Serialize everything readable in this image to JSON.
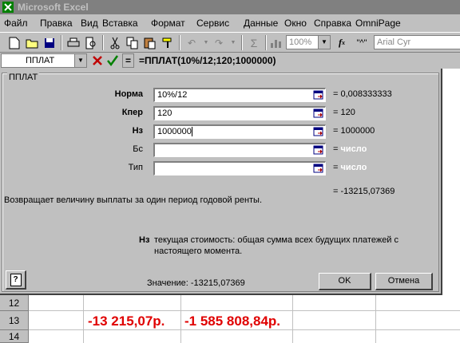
{
  "app": {
    "title": "Microsoft Excel"
  },
  "menu": [
    "Файл",
    "Правка",
    "Вид",
    "Вставка",
    "Формат",
    "Сервис",
    "Данные",
    "Окно",
    "Справка",
    "OmniPage"
  ],
  "toolbar": {
    "zoom": "100%",
    "font": "Arial Cyr",
    "quote_btn": "\"^\""
  },
  "formula_bar": {
    "name_box": "ППЛАТ",
    "formula": "=ППЛАТ(10%/12;120;1000000)",
    "equals": "="
  },
  "dialog": {
    "group_title": "ППЛАТ",
    "args": [
      {
        "label": "Норма",
        "value": "10%/12",
        "result": "= 0,008333333"
      },
      {
        "label": "Кпер",
        "value": "120",
        "result": "= 120"
      },
      {
        "label": "Нз",
        "value": "1000000",
        "result": "= 1000000"
      },
      {
        "label": "Бс",
        "value": "",
        "result_eq": "=",
        "result_word": "число"
      },
      {
        "label": "Тип",
        "value": "",
        "result_eq": "=",
        "result_word": "число"
      }
    ],
    "total_result": "= -13215,07369",
    "description": "Возвращает величину выплаты за один период годовой ренты.",
    "arg_help_name": "Нз",
    "arg_help_text1": "текущая стоимость: общая сумма всех будущих платежей с",
    "arg_help_text2": "настоящего момента.",
    "value_label": "Значение: -13215,07369",
    "ok": "OK",
    "cancel": "Отмена",
    "help_icon": "?"
  },
  "sheet": {
    "rows": [
      "12",
      "13",
      "14"
    ],
    "cells": {
      "b13": "-13 215,07р.",
      "c13": "-1 585 808,84р."
    }
  },
  "colors": {
    "result_red": "#e00000",
    "titlebar": "#808080"
  }
}
